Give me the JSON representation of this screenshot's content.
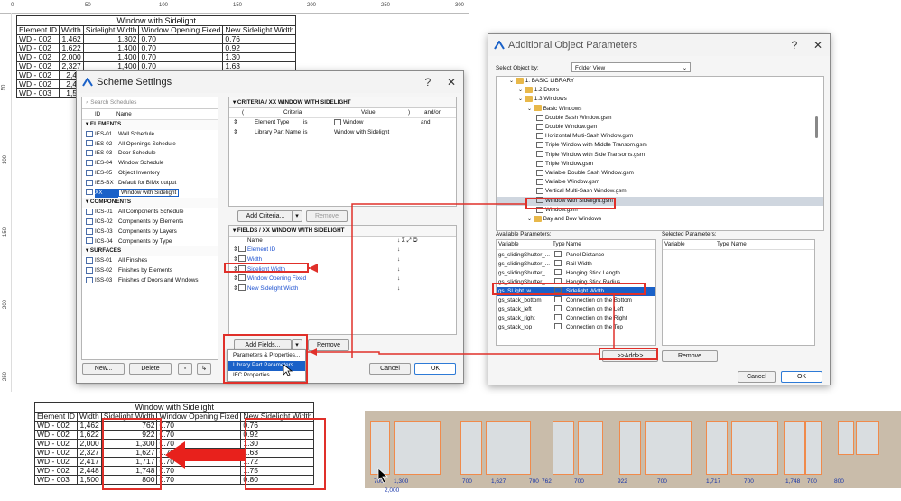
{
  "ruler": {
    "ticks": [
      "0",
      "50",
      "100",
      "150",
      "200",
      "250",
      "300"
    ]
  },
  "vruler": {
    "ticks": [
      "50",
      "100",
      "150",
      "200",
      "250"
    ]
  },
  "top_table": {
    "title": "Window with Sidelight",
    "headers": [
      "Element ID",
      "Width",
      "Sidelight Width",
      "Window Opening Fixed",
      "New Sidelight Width"
    ],
    "rows": [
      [
        "WD - 002",
        "1,462",
        "1,302",
        "0.70",
        "0.76"
      ],
      [
        "WD - 002",
        "1,622",
        "1,400",
        "0.70",
        "0.92"
      ],
      [
        "WD - 002",
        "2,000",
        "1,400",
        "0.70",
        "1.30"
      ],
      [
        "WD - 002",
        "2,327",
        "1,400",
        "0.70",
        "1.63"
      ],
      [
        "WD - 002",
        "2,41",
        "",
        "",
        ""
      ],
      [
        "WD - 002",
        "2,44",
        "",
        "",
        ""
      ],
      [
        "WD - 003",
        "1,50",
        "",
        "",
        ""
      ]
    ]
  },
  "bottom_table": {
    "title": "Window with Sidelight",
    "headers": [
      "Element ID",
      "Width",
      "Sidelight Width",
      "Window Opening Fixed",
      "New Sidelight Width"
    ],
    "rows": [
      [
        "WD - 002",
        "1,462",
        "762",
        "0.70",
        "0.76"
      ],
      [
        "WD - 002",
        "1,622",
        "922",
        "0.70",
        "0.92"
      ],
      [
        "WD - 002",
        "2,000",
        "1,300",
        "0.70",
        "1.30"
      ],
      [
        "WD - 002",
        "2,327",
        "1,627",
        "0.70",
        "1.63"
      ],
      [
        "WD - 002",
        "2,417",
        "1,717",
        "0.70",
        "1.72"
      ],
      [
        "WD - 002",
        "2,448",
        "1,748",
        "0.70",
        "1.75"
      ],
      [
        "WD - 003",
        "1,500",
        "800",
        "0.70",
        "0.80"
      ]
    ]
  },
  "scheme": {
    "title": "Scheme Settings",
    "help": "?",
    "close": "✕",
    "search_placeholder": "Search Schedules",
    "list_headers": {
      "id": "ID",
      "name": "Name"
    },
    "sections": [
      {
        "label": "ELEMENTS",
        "items": [
          {
            "id": "IES-01",
            "name": "Wall Schedule"
          },
          {
            "id": "IES-02",
            "name": "All Openings Schedule"
          },
          {
            "id": "IES-03",
            "name": "Door Schedule"
          },
          {
            "id": "IES-04",
            "name": "Window Schedule"
          },
          {
            "id": "IES-05",
            "name": "Object Inventory"
          },
          {
            "id": "IES-BX",
            "name": "Default for BIMx output"
          },
          {
            "id": "XX",
            "name": "Window with Sidelight"
          }
        ]
      },
      {
        "label": "COMPONENTS",
        "items": [
          {
            "id": "ICS-01",
            "name": "All Components Schedule"
          },
          {
            "id": "ICS-02",
            "name": "Components by Elements"
          },
          {
            "id": "ICS-03",
            "name": "Components by Layers"
          },
          {
            "id": "ICS-04",
            "name": "Components by Type"
          }
        ]
      },
      {
        "label": "SURFACES",
        "items": [
          {
            "id": "ISS-01",
            "name": "All Finishes"
          },
          {
            "id": "ISS-02",
            "name": "Finishes by Elements"
          },
          {
            "id": "ISS-03",
            "name": "Finishes of Doors and Windows"
          }
        ]
      }
    ],
    "new_btn": "New...",
    "delete_btn": "Delete",
    "criteria": {
      "header": "CRITERIA / XX WINDOW WITH SIDELIGHT",
      "cols": {
        "open": "(",
        "criteria": "Criteria",
        "value": "Value",
        "close": ")",
        "andor": "and/or"
      },
      "rows": [
        {
          "criteria": "Element Type",
          "op": "is",
          "value": "Window",
          "andor": "and"
        },
        {
          "criteria": "Library Part Name",
          "op": "is",
          "value": "Window with Sidelight",
          "andor": ""
        }
      ],
      "add_btn": "Add Criteria...",
      "remove_btn": "Remove"
    },
    "fields": {
      "header": "FIELDS / XX WINDOW WITH SIDELIGHT",
      "name_col": "Name",
      "icons_col": "↓ Σ ⤢ ◎",
      "rows": [
        "Element ID",
        "Width",
        "Sidelight Width",
        "Window Opening Fixed",
        "New Sidelight Width"
      ],
      "add_btn": "Add Fields...",
      "remove_btn": "Remove"
    },
    "menu": [
      "Parameters & Properties...",
      "Library Part Parameters...",
      "IFC Properties..."
    ],
    "cancel": "Cancel",
    "ok": "OK"
  },
  "aop": {
    "title": "Additional Object Parameters",
    "help": "?",
    "close": "✕",
    "select_label": "Select Object by:",
    "select_value": "Folder View",
    "tree": [
      {
        "label": "1. BASIC LIBRARY",
        "indent": 0,
        "kind": "folder"
      },
      {
        "label": "1.2 Doors",
        "indent": 1,
        "kind": "folder"
      },
      {
        "label": "1.3 Windows",
        "indent": 1,
        "kind": "folder"
      },
      {
        "label": "Basic Windows",
        "indent": 2,
        "kind": "folder"
      },
      {
        "label": "Double Sash Window.gsm",
        "indent": 3,
        "kind": "file"
      },
      {
        "label": "Double Window.gsm",
        "indent": 3,
        "kind": "file"
      },
      {
        "label": "Horizontal Multi-Sash Window.gsm",
        "indent": 3,
        "kind": "file"
      },
      {
        "label": "Triple Window with Middle Transom.gsm",
        "indent": 3,
        "kind": "file"
      },
      {
        "label": "Triple Window with Side Transoms.gsm",
        "indent": 3,
        "kind": "file"
      },
      {
        "label": "Triple Window.gsm",
        "indent": 3,
        "kind": "file"
      },
      {
        "label": "Variable Double Sash Window.gsm",
        "indent": 3,
        "kind": "file"
      },
      {
        "label": "Variable Window.gsm",
        "indent": 3,
        "kind": "file"
      },
      {
        "label": "Vertical Multi-Sash Window.gsm",
        "indent": 3,
        "kind": "file"
      },
      {
        "label": "Window with Sidelight.gsm",
        "indent": 3,
        "kind": "file"
      },
      {
        "label": "Window.gsm",
        "indent": 3,
        "kind": "file"
      },
      {
        "label": "Bay and Bow Windows",
        "indent": 2,
        "kind": "folder"
      }
    ],
    "available_label": "Available Parameters:",
    "selected_label": "Selected Parameters:",
    "avail_cols": {
      "variable": "Variable",
      "type": "Type",
      "name": "Name"
    },
    "avail_rows": [
      {
        "variable": "gs_slidingShutter_...",
        "name": "Panel Distance"
      },
      {
        "variable": "gs_slidingShutter_...",
        "name": "Rail Width"
      },
      {
        "variable": "gs_slidingShutter_...",
        "name": "Hanging Stick Length"
      },
      {
        "variable": "gs_slidingShutter_...",
        "name": "Hanging Stick Radius"
      },
      {
        "variable": "gs_SLight_w",
        "name": "Sidelight Width"
      },
      {
        "variable": "gs_stack_bottom",
        "name": "Connection on the Bottom"
      },
      {
        "variable": "gs_stack_left",
        "name": "Connection on the Left"
      },
      {
        "variable": "gs_stack_right",
        "name": "Connection on the Right"
      },
      {
        "variable": "gs_stack_top",
        "name": "Connection on the Top"
      }
    ],
    "sel_cols": {
      "variable": "Variable",
      "type": "Type",
      "name": "Name"
    },
    "add_btn": ">>Add>>",
    "remove_btn": "Remove",
    "cancel": "Cancel",
    "ok": "OK"
  },
  "elevation": {
    "dims": [
      "700",
      "1,300",
      "2,000",
      "700",
      "1,627",
      "700",
      "762",
      "700",
      "922",
      "700",
      "1,717",
      "700",
      "1,748",
      "700",
      "800"
    ]
  }
}
